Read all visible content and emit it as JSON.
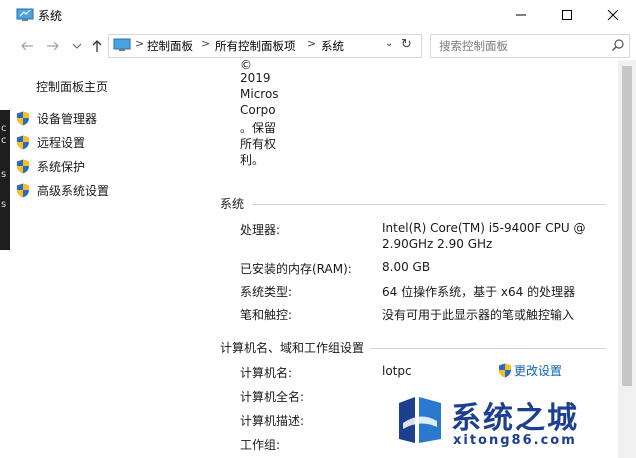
{
  "background": {
    "glyphs": [
      "c",
      "c",
      "s",
      "s"
    ]
  },
  "window": {
    "title": "系统"
  },
  "address_bar": {
    "crumbs": [
      "控制面板",
      "所有控制面板项",
      "系统"
    ],
    "separator": ">"
  },
  "search": {
    "placeholder": "搜索控制面板"
  },
  "sidebar": {
    "home": "控制面板主页",
    "items": [
      {
        "label": "设备管理器",
        "icon": "shield-icon"
      },
      {
        "label": "远程设置",
        "icon": "shield-icon"
      },
      {
        "label": "系统保护",
        "icon": "shield-icon"
      },
      {
        "label": "高级系统设置",
        "icon": "shield-icon"
      }
    ]
  },
  "copyright_lines": [
    "©",
    "2019",
    "Micros",
    "Corpo",
    "。保留",
    "所有权",
    "利。"
  ],
  "system_section": {
    "title": "系统",
    "rows": [
      {
        "label": "处理器:",
        "value": "Intel(R) Core(TM) i5-9400F CPU @",
        "value2": "2.90GHz   2.90 GHz"
      },
      {
        "label": "已安装的内存(RAM):",
        "value": "8.00 GB"
      },
      {
        "label": "系统类型:",
        "value": "64 位操作系统，基于 x64 的处理器"
      },
      {
        "label": "笔和触控:",
        "value": "没有可用于此显示器的笔或触控输入"
      }
    ]
  },
  "computer_section": {
    "title": "计算机名、域和工作组设置",
    "rows": [
      {
        "label": "计算机名:",
        "value": "lotpc"
      },
      {
        "label": "计算机全名:",
        "value": ""
      },
      {
        "label": "计算机描述:",
        "value": ""
      },
      {
        "label": "工作组:",
        "value": ""
      }
    ],
    "change_link": "更改设置"
  },
  "watermark": {
    "title": "系统之城",
    "subtitle": "xitong86.com"
  },
  "colors": {
    "link": "#0b64b8",
    "watermark": "#1c3f8f",
    "shield_blue": "#2a67c7",
    "shield_yellow": "#f2c21b"
  }
}
